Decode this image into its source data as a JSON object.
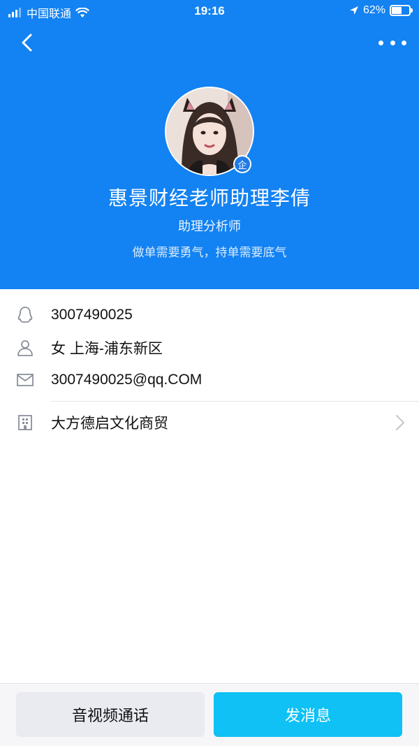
{
  "status_bar": {
    "carrier": "中国联通",
    "time": "19:16",
    "battery": "62%",
    "battery_level": 0.62
  },
  "profile": {
    "name": "惠景财经老师助理李倩",
    "title": "助理分析师",
    "motto": "做单需要勇气，持单需要底气",
    "badge": "企"
  },
  "info": {
    "qq": "3007490025",
    "gender_location": "女 上海-浦东新区",
    "email": "3007490025@qq.COM",
    "company": "大方德启文化商贸"
  },
  "actions": {
    "call_label": "音视频通话",
    "message_label": "发消息"
  },
  "colors": {
    "header_bg": "#1382f2",
    "message_button": "#0fc1f5",
    "call_button": "#e9ebf1"
  }
}
